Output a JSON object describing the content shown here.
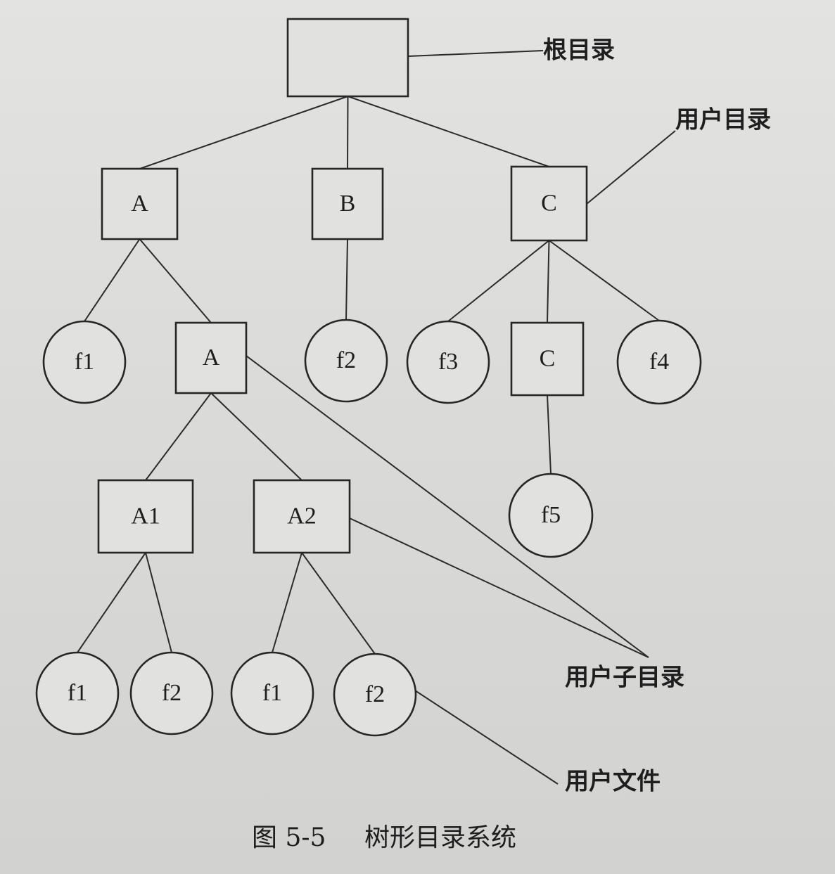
{
  "diagram": {
    "nodes": [
      {
        "id": "root",
        "shape": "box",
        "label": ""
      },
      {
        "id": "A",
        "shape": "box",
        "label": "A"
      },
      {
        "id": "B",
        "shape": "box",
        "label": "B"
      },
      {
        "id": "C",
        "shape": "box",
        "label": "C"
      },
      {
        "id": "A_f1",
        "shape": "circle",
        "label": "f1"
      },
      {
        "id": "A_A",
        "shape": "box",
        "label": "A"
      },
      {
        "id": "B_f2",
        "shape": "circle",
        "label": "f2"
      },
      {
        "id": "C_f3",
        "shape": "circle",
        "label": "f3"
      },
      {
        "id": "C_C",
        "shape": "box",
        "label": "C"
      },
      {
        "id": "C_f4",
        "shape": "circle",
        "label": "f4"
      },
      {
        "id": "C_C_f5",
        "shape": "circle",
        "label": "f5"
      },
      {
        "id": "A1",
        "shape": "box",
        "label": "A1"
      },
      {
        "id": "A2",
        "shape": "box",
        "label": "A2"
      },
      {
        "id": "A1_f1",
        "shape": "circle",
        "label": "f1"
      },
      {
        "id": "A1_f2",
        "shape": "circle",
        "label": "f2"
      },
      {
        "id": "A2_f1",
        "shape": "circle",
        "label": "f1"
      },
      {
        "id": "A2_f2",
        "shape": "circle",
        "label": "f2"
      }
    ],
    "edges": [
      [
        "root",
        "A"
      ],
      [
        "root",
        "B"
      ],
      [
        "root",
        "C"
      ],
      [
        "A",
        "A_f1"
      ],
      [
        "A",
        "A_A"
      ],
      [
        "B",
        "B_f2"
      ],
      [
        "C",
        "C_f3"
      ],
      [
        "C",
        "C_C"
      ],
      [
        "C",
        "C_f4"
      ],
      [
        "C_C",
        "C_C_f5"
      ],
      [
        "A_A",
        "A1"
      ],
      [
        "A_A",
        "A2"
      ],
      [
        "A1",
        "A1_f1"
      ],
      [
        "A1",
        "A1_f2"
      ],
      [
        "A2",
        "A2_f1"
      ],
      [
        "A2",
        "A2_f2"
      ]
    ],
    "annotations": [
      {
        "id": "root-directory",
        "text": "根目录",
        "targets": [
          "root"
        ]
      },
      {
        "id": "user-directory",
        "text": "用户目录",
        "targets": [
          "C"
        ]
      },
      {
        "id": "user-subdirectory",
        "text": "用户子目录",
        "targets": [
          "A_A",
          "A2"
        ]
      },
      {
        "id": "user-file",
        "text": "用户文件",
        "targets": [
          "A2_f2"
        ]
      }
    ],
    "caption": {
      "figure_number": "图 5-5",
      "title": "树形目录系统"
    }
  }
}
